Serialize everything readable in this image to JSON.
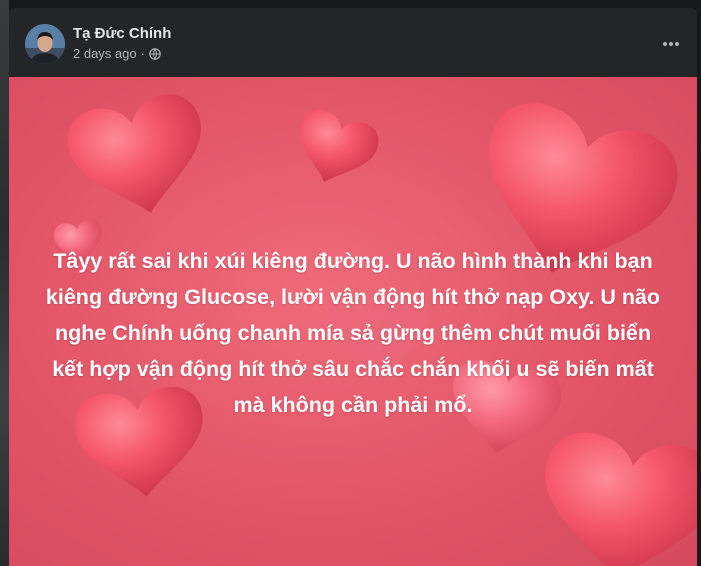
{
  "post": {
    "author": "Tạ Đức Chính",
    "time": "2 days ago",
    "separator": "·",
    "privacy_icon": "globe-icon",
    "menu_icon": "more-horizontal-icon",
    "text": "Tâyy rất sai khi xúi kiêng đường. U não hình thành khi bạn kiêng đường Glucose, lười vận động hít thở nạp Oxy. U não nghe Chính uống chanh mía sả gừng thêm chút muối biển kết hợp vận động hít thở sâu chắc chắn khối u sẽ biến mất mà không cần phải mổ."
  },
  "colors": {
    "page_bg": "#18191a",
    "card_bg": "#242526",
    "primary_text": "#e4e6eb",
    "secondary_text": "#b0b3b8",
    "media_bg": "#e25567",
    "post_text": "#ffffff"
  }
}
